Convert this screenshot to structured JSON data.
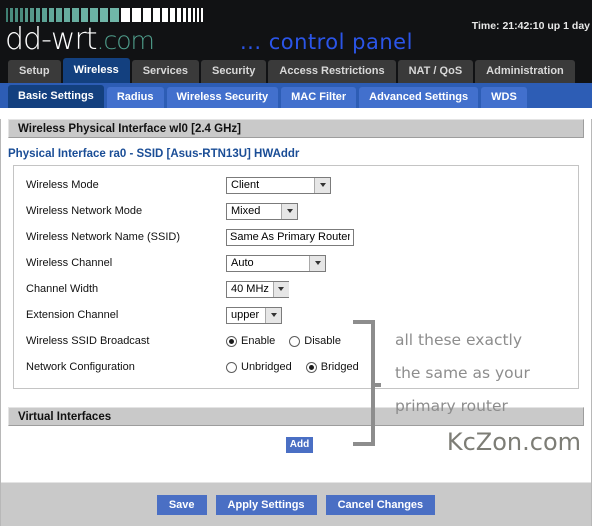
{
  "header": {
    "logo_main": "dd-wrt",
    "logo_suffix": ".com",
    "tagline": "... control panel",
    "clock": "Time: 21:42:10 up 1 day",
    "bars": [
      {
        "w": 2,
        "color": "#3f7f72"
      },
      {
        "w": 3,
        "color": "#4a8c7e"
      },
      {
        "w": 3,
        "color": "#4a8c7e"
      },
      {
        "w": 3,
        "color": "#4a8c7e"
      },
      {
        "w": 3,
        "color": "#56988a"
      },
      {
        "w": 4,
        "color": "#56988a"
      },
      {
        "w": 4,
        "color": "#5ba294"
      },
      {
        "w": 5,
        "color": "#5ba294"
      },
      {
        "w": 5,
        "color": "#62a89a"
      },
      {
        "w": 6,
        "color": "#62a89a"
      },
      {
        "w": 6,
        "color": "#67ad9f"
      },
      {
        "w": 7,
        "color": "#67ad9f"
      },
      {
        "w": 7,
        "color": "#6bb2a4"
      },
      {
        "w": 8,
        "color": "#6bb2a4"
      },
      {
        "w": 8,
        "color": "#70b6a8"
      },
      {
        "w": 9,
        "color": "#70b6a8"
      },
      {
        "w": 9,
        "color": "#ffffff"
      },
      {
        "w": 9,
        "color": "#ffffff"
      },
      {
        "w": 8,
        "color": "#ffffff"
      },
      {
        "w": 7,
        "color": "#ffffff"
      },
      {
        "w": 6,
        "color": "#ffffff"
      },
      {
        "w": 5,
        "color": "#ffffff"
      },
      {
        "w": 4,
        "color": "#ffffff"
      },
      {
        "w": 3,
        "color": "#ffffff"
      },
      {
        "w": 3,
        "color": "#ffffff"
      },
      {
        "w": 2,
        "color": "#ffffff"
      },
      {
        "w": 2,
        "color": "#ffffff"
      },
      {
        "w": 2,
        "color": "#ffffff"
      }
    ]
  },
  "primary_tabs": [
    {
      "label": "Setup",
      "active": false
    },
    {
      "label": "Wireless",
      "active": true
    },
    {
      "label": "Services",
      "active": false
    },
    {
      "label": "Security",
      "active": false
    },
    {
      "label": "Access Restrictions",
      "active": false
    },
    {
      "label": "NAT / QoS",
      "active": false
    },
    {
      "label": "Administration",
      "active": false
    }
  ],
  "secondary_tabs": [
    {
      "label": "Basic Settings",
      "active": true
    },
    {
      "label": "Radius",
      "active": false
    },
    {
      "label": "Wireless Security",
      "active": false
    },
    {
      "label": "MAC Filter",
      "active": false
    },
    {
      "label": "Advanced Settings",
      "active": false
    },
    {
      "label": "WDS",
      "active": false
    }
  ],
  "physical_section": {
    "title": "Wireless Physical Interface wl0 [2.4 GHz]",
    "subheading": "Physical Interface ra0 - SSID [Asus-RTN13U] HWAddr",
    "fields": {
      "wireless_mode": {
        "label": "Wireless Mode",
        "value": "Client"
      },
      "wireless_network_mode": {
        "label": "Wireless Network Mode",
        "value": "Mixed"
      },
      "ssid": {
        "label": "Wireless Network Name (SSID)",
        "value": "Same As Primary Router",
        "placeholder": ""
      },
      "wireless_channel": {
        "label": "Wireless Channel",
        "value": "Auto"
      },
      "channel_width": {
        "label": "Channel Width",
        "value": "40 MHz"
      },
      "extension_channel": {
        "label": "Extension Channel",
        "value": "upper"
      },
      "ssid_broadcast": {
        "label": "Wireless SSID Broadcast",
        "options": [
          {
            "label": "Enable",
            "selected": true
          },
          {
            "label": "Disable",
            "selected": false
          }
        ]
      },
      "network_configuration": {
        "label": "Network Configuration",
        "options": [
          {
            "label": "Unbridged",
            "selected": false
          },
          {
            "label": "Bridged",
            "selected": true
          }
        ]
      }
    }
  },
  "annotation": {
    "line1": "all these exactly",
    "line2": "the same as your",
    "line3": "primary router"
  },
  "virtual_section": {
    "title": "Virtual Interfaces",
    "add_label": "Add"
  },
  "watermark": "KcZon.com",
  "actions": {
    "save": "Save",
    "apply": "Apply Settings",
    "cancel": "Cancel Changes"
  },
  "colors": {
    "accent_blue": "#4a6fc4",
    "tab_active": "#13407f",
    "header_bg": "#111214",
    "logo_teal": "#4f9e8c",
    "tagline_blue": "#2b55e8",
    "annotation_gray": "#8d8d8d"
  }
}
